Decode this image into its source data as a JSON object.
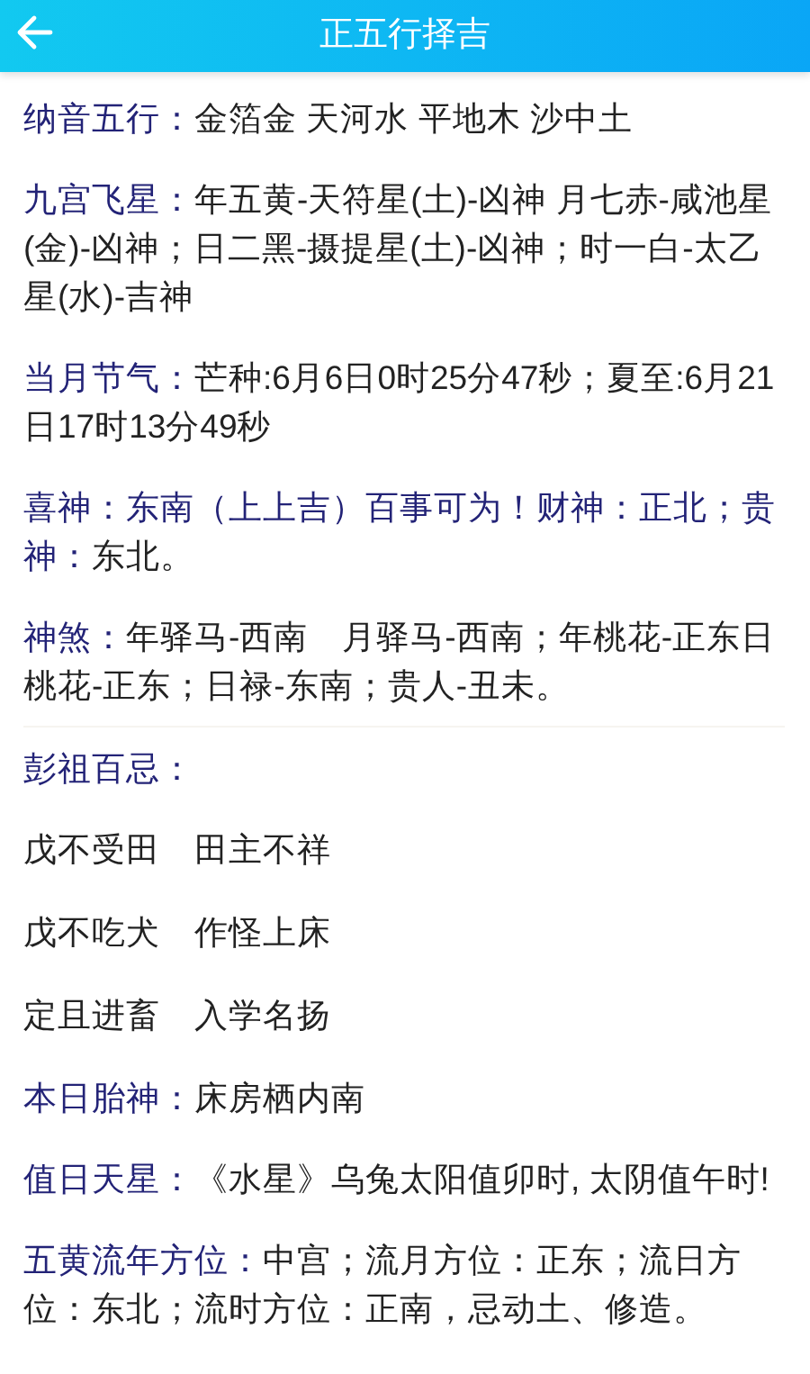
{
  "header": {
    "title": "正五行择吉"
  },
  "sections": [
    {
      "kind": "entry",
      "label": "纳音五行：",
      "value": "金箔金 天河水 平地木 沙中土"
    },
    {
      "kind": "entry",
      "label": "九宫飞星：",
      "value": "年五黄-天符星(土)-凶神 月七赤-咸池星(金)-凶神；日二黑-摄提星(土)-凶神；时一白-太乙星(水)-吉神"
    },
    {
      "kind": "entry",
      "label": "当月节气：",
      "value": "芒种:6月6日0时25分47秒；夏至:6月21日17时13分49秒"
    },
    {
      "kind": "entry",
      "label": "喜神：东南（上上吉）百事可为！财神：正北；贵神：",
      "value": "东北。"
    },
    {
      "kind": "entry",
      "label": "神煞：",
      "value": "年驿马-西南　月驿马-西南；年桃花-正东日桃花-正东；日禄-东南；贵人-丑未。"
    },
    {
      "kind": "heading",
      "label": "彭祖百忌："
    },
    {
      "kind": "pair",
      "parts": [
        "戊不受田",
        "田主不祥"
      ]
    },
    {
      "kind": "pair",
      "parts": [
        "戊不吃犬",
        "作怪上床"
      ]
    },
    {
      "kind": "pair",
      "parts": [
        "定且进畜",
        "入学名扬"
      ]
    },
    {
      "kind": "entry",
      "label": "本日胎神：",
      "value": "床房栖内南"
    },
    {
      "kind": "entry",
      "label": "值日天星：",
      "value": "《水星》乌兔太阳值卯时, 太阴值午时!"
    },
    {
      "kind": "entry",
      "label": "五黄流年方位：",
      "value": "中宫；流月方位：正东；流日方位：东北；流时方位：正南，忌动土、修造。"
    }
  ]
}
